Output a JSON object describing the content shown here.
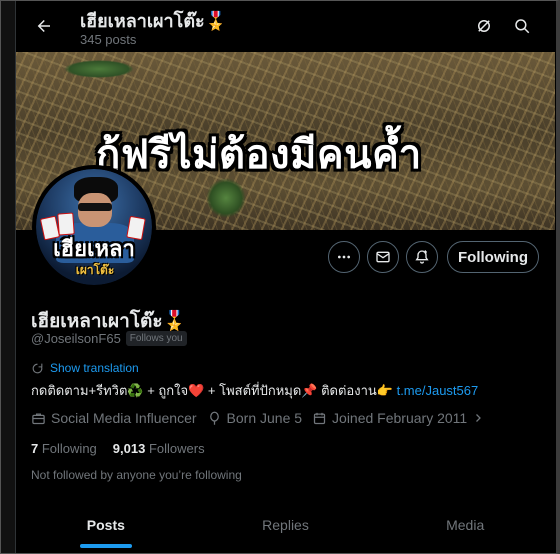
{
  "header": {
    "title": "เฮียเหลาเผาโต๊ะ🎖️",
    "post_count": "345 posts"
  },
  "banner": {
    "caption": "กู้ฟรีไม่ต้องมีคนค้ำ"
  },
  "avatar": {
    "logo_text": "เฮียเหลา",
    "logo_sub": "เผาโต๊ะ"
  },
  "actions": {
    "follow_label": "Following"
  },
  "profile": {
    "name": "เฮียเหลาเผาโต๊ะ🎖️",
    "handle": "@JoseilsonF65",
    "follows_you": "Follows you",
    "show_translation": "Show translation",
    "bio_text": "กดติดตาม+รีทวิต♻️ + ถูกใจ❤️ + โพสต์ที่ปักหมุด📌 ติดต่องาน👉 ",
    "bio_link": "t.me/Jaust567",
    "category": "Social Media Influencer",
    "birthday": "Born June 5",
    "joined": "Joined February 2011"
  },
  "stats": {
    "following_count": "7",
    "following_label": "Following",
    "followers_count": "9,013",
    "followers_label": "Followers"
  },
  "not_followed_text": "Not followed by anyone you’re following",
  "tabs": [
    {
      "label": "Posts",
      "active": true
    },
    {
      "label": "Replies",
      "active": false
    },
    {
      "label": "Media",
      "active": false
    }
  ],
  "colors": {
    "accent": "#1d9bf0",
    "muted": "#71767b",
    "text": "#e7e9ea",
    "background": "#000000"
  },
  "icons": {
    "back": "arrow-left-icon",
    "grok": "grok-icon",
    "search": "search-icon",
    "more": "more-icon",
    "message": "message-icon",
    "notify": "notification-bell-icon",
    "translate": "translate-icon",
    "category": "briefcase-icon",
    "birthday": "balloon-icon",
    "joined": "calendar-icon"
  }
}
